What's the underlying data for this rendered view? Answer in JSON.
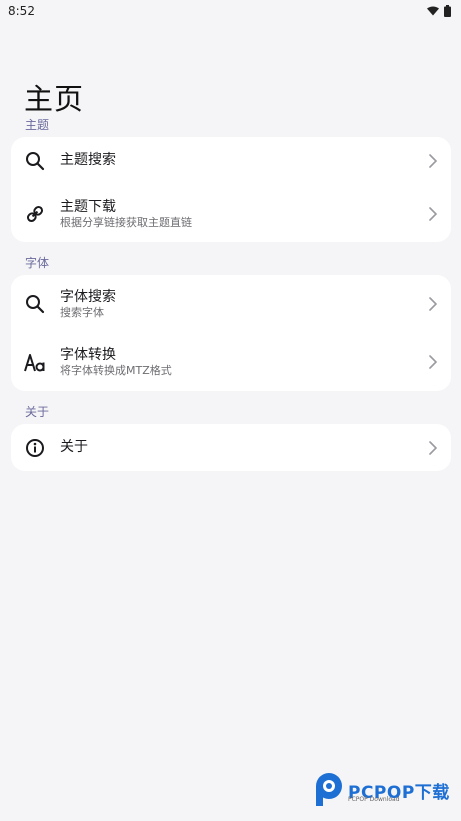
{
  "status_bar": {
    "time": "8:52",
    "icons": [
      "wifi-icon",
      "battery-icon"
    ]
  },
  "page": {
    "title": "主页"
  },
  "sections": [
    {
      "label": "主题",
      "items": [
        {
          "icon": "search-icon",
          "title": "主题搜索",
          "subtitle": ""
        },
        {
          "icon": "link-icon",
          "title": "主题下载",
          "subtitle": "根据分享链接获取主题直链"
        }
      ]
    },
    {
      "label": "字体",
      "items": [
        {
          "icon": "search-icon",
          "title": "字体搜索",
          "subtitle": "搜索字体"
        },
        {
          "icon": "font-icon",
          "title": "字体转换",
          "subtitle": "将字体转换成MTZ格式"
        }
      ]
    },
    {
      "label": "关于",
      "items": [
        {
          "icon": "info-icon",
          "title": "关于",
          "subtitle": ""
        }
      ]
    }
  ],
  "watermark": {
    "brand": "PCPOP下载",
    "tagline": "PCPOP Download"
  },
  "colors": {
    "background": "#f5f5f7",
    "card": "#ffffff",
    "section_label": "#6b6a9c",
    "watermark": "#1d6fd4"
  }
}
